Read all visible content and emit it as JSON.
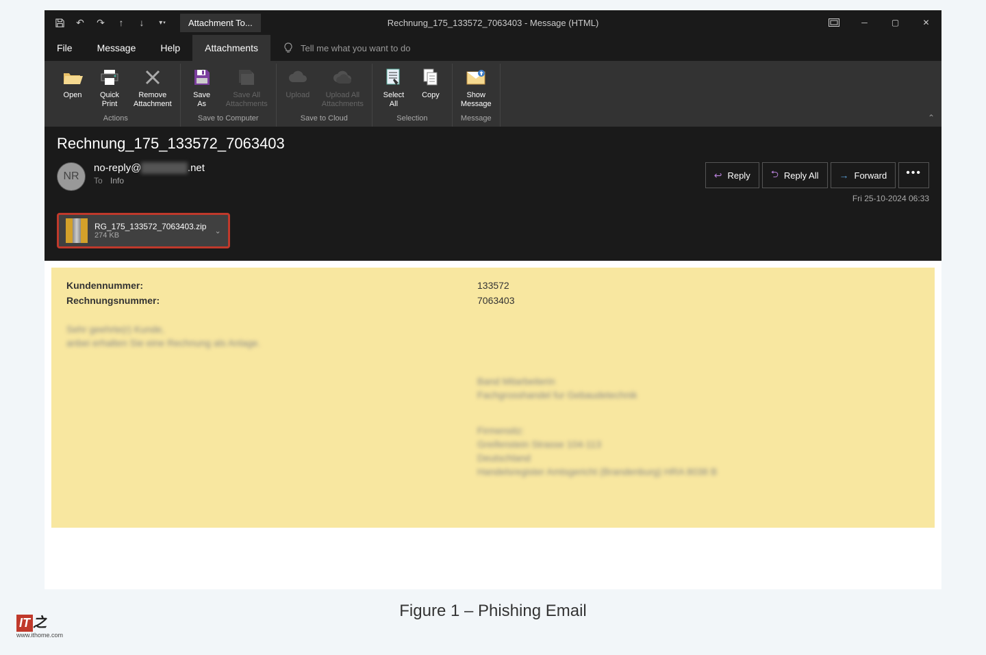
{
  "qat_tab": "Attachment To...",
  "window_title": "Rechnung_175_133572_7063403  -  Message (HTML)",
  "menu": {
    "file": "File",
    "message": "Message",
    "help": "Help",
    "attachments": "Attachments"
  },
  "tell_me": "Tell me what you want to do",
  "ribbon": {
    "open": "Open",
    "quick_print": "Quick\nPrint",
    "remove": "Remove\nAttachment",
    "save_as": "Save\nAs",
    "save_all": "Save All\nAttachments",
    "upload": "Upload",
    "upload_all": "Upload All\nAttachments",
    "select_all": "Select\nAll",
    "copy": "Copy",
    "show_msg": "Show\nMessage",
    "grp_actions": "Actions",
    "grp_save_comp": "Save to Computer",
    "grp_save_cloud": "Save to Cloud",
    "grp_selection": "Selection",
    "grp_message": "Message"
  },
  "subject": "Rechnung_175_133572_7063403",
  "avatar_initials": "NR",
  "sender": {
    "prefix": "no-reply@",
    "redacted": "xxxxxxxxx",
    "suffix": ".net"
  },
  "to": {
    "label": "To",
    "value": "Info"
  },
  "actions": {
    "reply": "Reply",
    "reply_all": "Reply All",
    "forward": "Forward"
  },
  "timestamp": "Fri 25-10-2024 06:33",
  "attachment": {
    "name": "RG_175_133572_7063403.zip",
    "size": "274 KB"
  },
  "body": {
    "kunde_label": "Kundennummer:",
    "kunde_val": "133572",
    "rech_label": "Rechnungsnummer:",
    "rech_val": "7063403",
    "line1": "Sehr geehrte(r) Kunde,",
    "line2": "anbei erhalten Sie eine Rechnung als Anlage.",
    "sig1": "Band Mitarbeiterin",
    "sig2": "Fachgrosshandel fur Gebaudetechnik",
    "sig3": "Firmensitz:",
    "sig4": "Greifenstein Strasse 104-113",
    "sig5": "Deutschland",
    "sig6": "Handelsregister Amtsgericht (Brandenburg)  HRA 8038 B"
  },
  "caption": "Figure 1 – Phishing Email",
  "watermark": {
    "logo": "IT",
    "url": "www.ithome.com"
  }
}
